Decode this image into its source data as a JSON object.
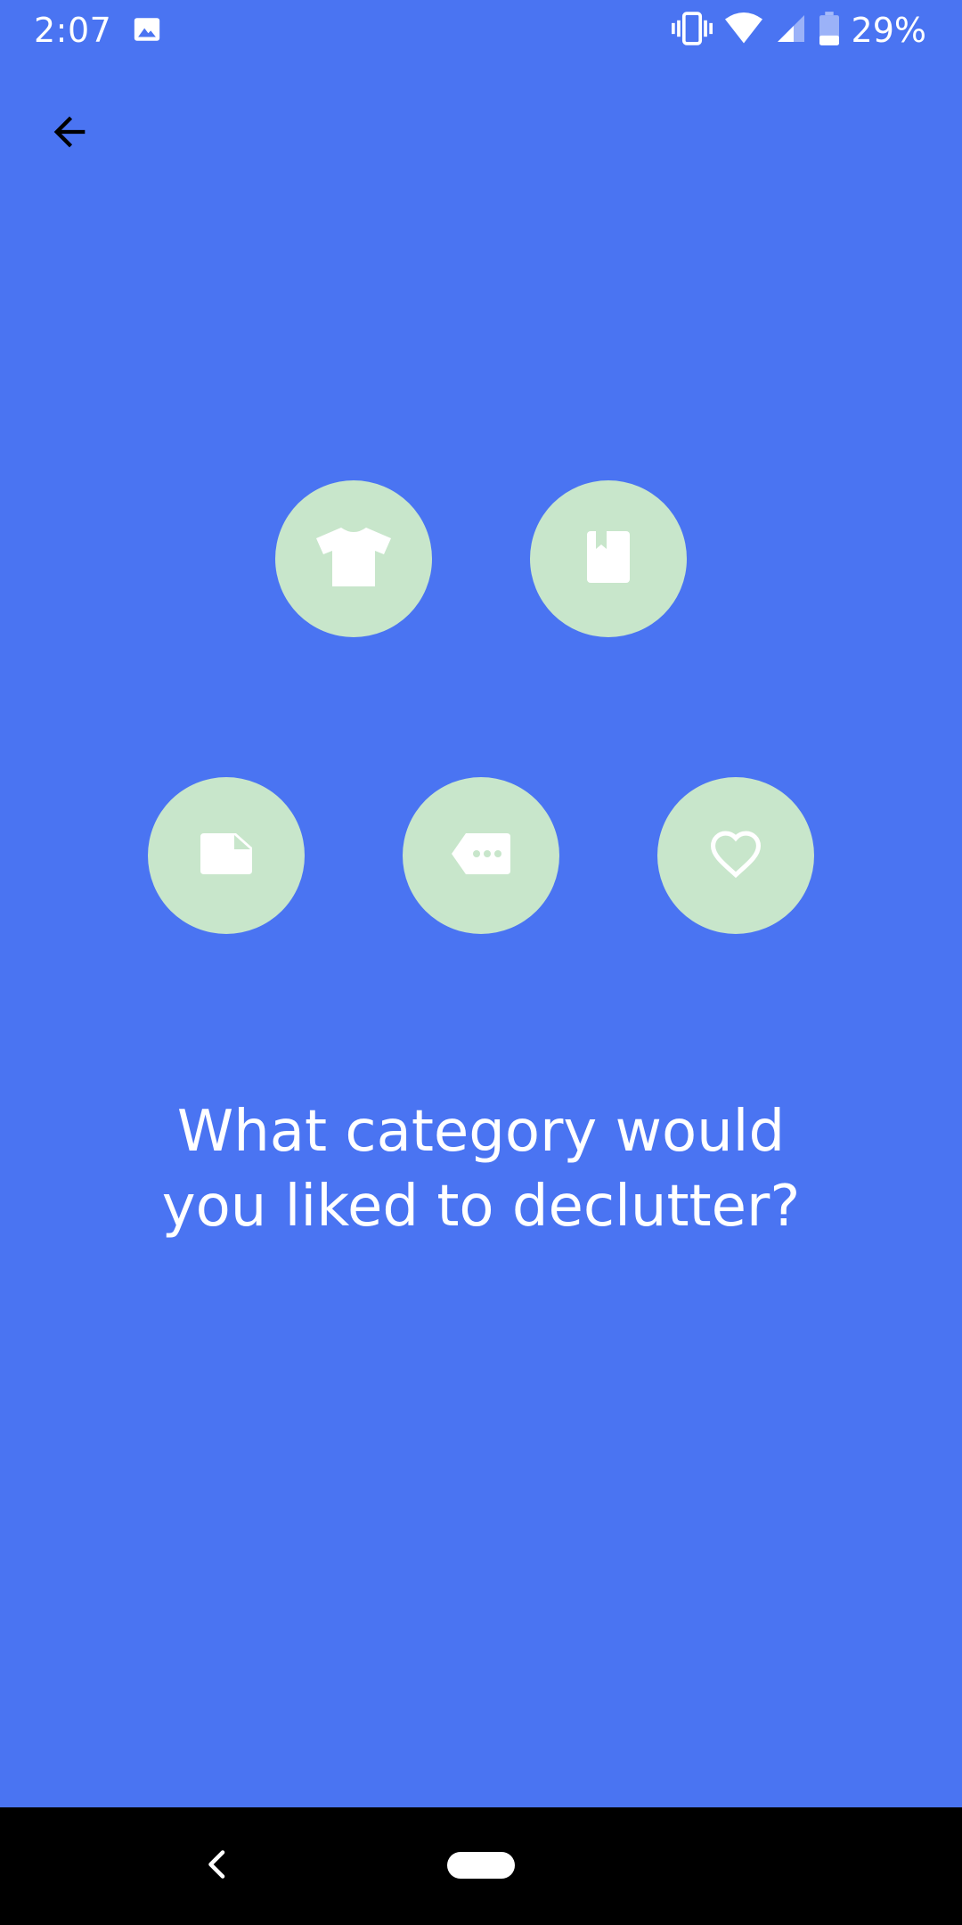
{
  "status_bar": {
    "time": "2:07",
    "battery_percent": "29%",
    "icons": [
      "image-icon",
      "vibrate-icon",
      "wifi-icon",
      "signal-icon",
      "battery-icon"
    ]
  },
  "header": {
    "back_icon": "arrow-left-icon"
  },
  "categories": [
    {
      "id": "clothes",
      "icon": "tshirt-icon"
    },
    {
      "id": "books",
      "icon": "book-icon"
    },
    {
      "id": "papers",
      "icon": "note-icon"
    },
    {
      "id": "misc",
      "icon": "tag-icon"
    },
    {
      "id": "sentimental",
      "icon": "heart-icon"
    }
  ],
  "prompt": {
    "line1": "What category would",
    "line2": "you liked to declutter?"
  },
  "colors": {
    "background": "#4A74F2",
    "circle": "#C8E6CB",
    "icon": "#FFFFFF",
    "nav_bar": "#000000"
  }
}
